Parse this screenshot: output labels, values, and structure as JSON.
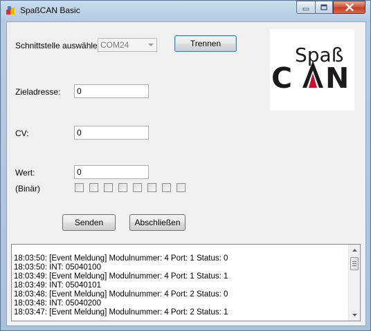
{
  "window": {
    "title": "SpaßCAN Basic"
  },
  "interface": {
    "label": "Schnittstelle auswählen",
    "port_value": "COM24",
    "disconnect_button": "Trennen"
  },
  "logo": {
    "line1": "Spaß",
    "line2_left": "C",
    "line2_right": "N",
    "colors": {
      "dark": "#1a1a1a",
      "red": "#c8102e"
    }
  },
  "fields": {
    "target_label": "Zieladresse:",
    "target_value": "0",
    "cv_label": "CV:",
    "cv_value": "0",
    "value_label": "Wert:",
    "value_value": "0",
    "binary_label": "(Binär)"
  },
  "binary_bits": [
    false,
    false,
    false,
    false,
    false,
    false,
    false,
    false
  ],
  "buttons": {
    "send": "Senden",
    "finish": "Abschließen"
  },
  "log": [
    "18:03:50: [Event Meldung] Modulnummer:  4 Port:  1 Status:  0",
    "18:03:50: INT: 05040100",
    "18:03:49: [Event Meldung] Modulnummer:  4 Port:  1 Status:  1",
    "18:03:49: INT: 05040101",
    "18:03:48: [Event Meldung] Modulnummer:  4 Port:  2 Status:  0",
    "18:03:48: INT: 05040200",
    "18:03:47: [Event Meldung] Modulnummer:  4 Port:  2 Status:  1"
  ]
}
